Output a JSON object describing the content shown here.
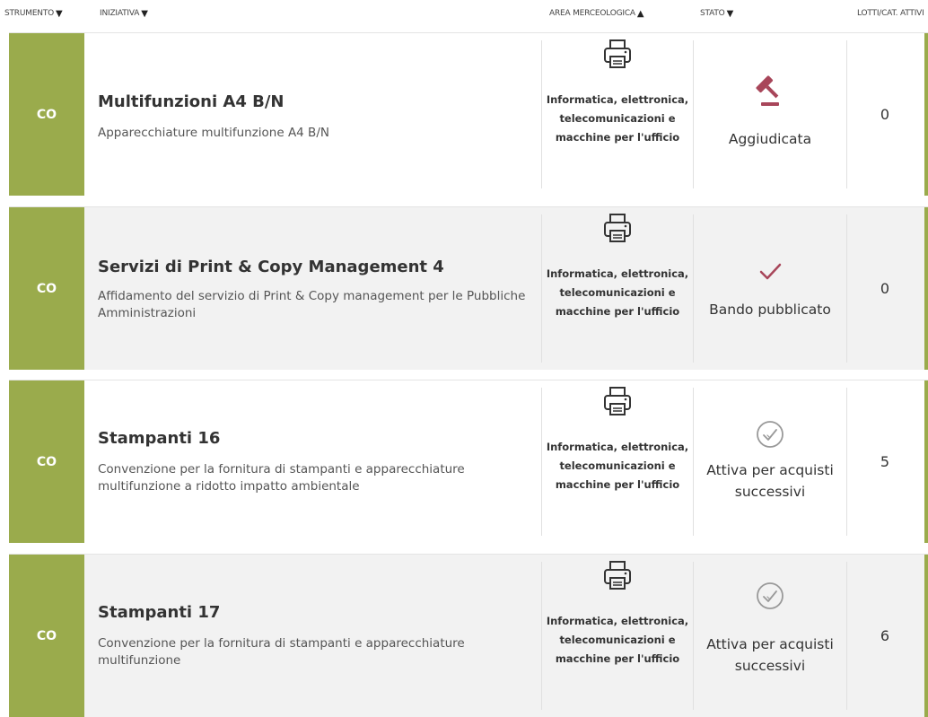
{
  "header": {
    "strumento": "STRUMENTO",
    "iniziativa": "INIZIATIVA",
    "area": "AREA MERCEOLOGICA",
    "stato": "STATO",
    "lotti": "LOTTI/CAT. ATTIVI"
  },
  "colors": {
    "accent": "#9aab4c",
    "auction": "#a8465a",
    "check": "#a8465a",
    "muted_icon": "#999999"
  },
  "rows": [
    {
      "tag": "CO",
      "title": "Multifunzioni A4 B/N",
      "description": "Apparecchiature multifunzione A4 B/N",
      "area_icon": "printer-icon",
      "area": "Informatica, elettronica, telecomunicazioni e macchine per l'ufficio",
      "stato_icon": "gavel-icon",
      "stato": "Aggiudicata",
      "lotti": "0"
    },
    {
      "tag": "CO",
      "title": "Servizi di Print & Copy Management 4",
      "description": "Affidamento del servizio di Print & Copy management per le Pubbliche Amministrazioni",
      "area_icon": "printer-icon",
      "area": "Informatica, elettronica, telecomunicazioni e macchine per l'ufficio",
      "stato_icon": "checkmark-icon",
      "stato": "Bando pubblicato",
      "lotti": "0"
    },
    {
      "tag": "CO",
      "title": "Stampanti 16",
      "description": "Convenzione per la fornitura di stampanti e apparecchiature multifunzione a ridotto impatto ambientale",
      "area_icon": "printer-icon",
      "area": "Informatica, elettronica, telecomunicazioni e macchine per l'ufficio",
      "stato_icon": "circle-check-icon",
      "stato": "Attiva per acquisti successivi",
      "lotti": "5"
    },
    {
      "tag": "CO",
      "title": "Stampanti 17",
      "description": "Convenzione per la fornitura di stampanti e apparecchiature multifunzione",
      "area_icon": "printer-icon",
      "area": "Informatica, elettronica, telecomunicazioni e macchine per l'ufficio",
      "stato_icon": "circle-check-icon",
      "stato": "Attiva per acquisti successivi",
      "lotti": "6"
    }
  ]
}
